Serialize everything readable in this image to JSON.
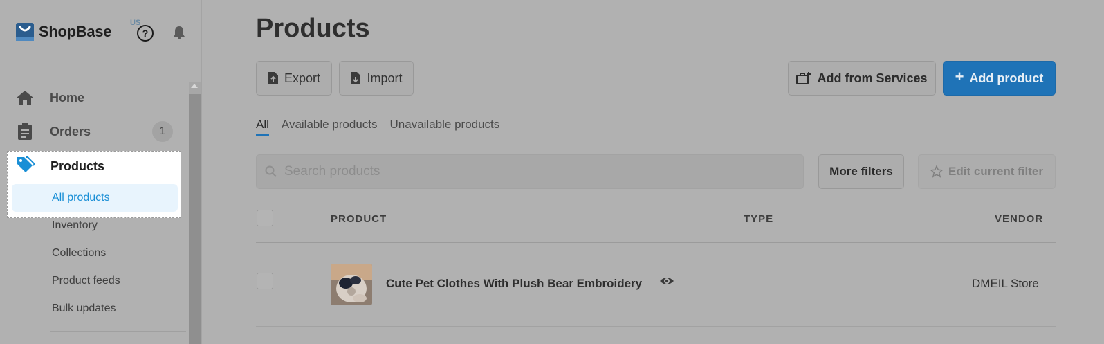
{
  "brand": {
    "name": "ShopBase",
    "region": "US"
  },
  "sidebar": {
    "items": [
      {
        "label": "Home"
      },
      {
        "label": "Orders",
        "badge": "1"
      },
      {
        "label": "Products"
      }
    ],
    "products_sub": [
      "All products",
      "Inventory",
      "Collections",
      "Product feeds",
      "Bulk updates"
    ]
  },
  "page": {
    "title": "Products",
    "export_label": "Export",
    "import_label": "Import",
    "add_from_services_label": "Add from Services",
    "add_product_label": "Add product"
  },
  "tabs": [
    "All",
    "Available products",
    "Unavailable products"
  ],
  "active_tab": "All",
  "search": {
    "placeholder": "Search products",
    "value": ""
  },
  "filters": {
    "more_label": "More filters",
    "edit_label": "Edit current filter"
  },
  "table": {
    "columns": [
      "PRODUCT",
      "TYPE",
      "VENDOR"
    ],
    "rows": [
      {
        "product": "Cute Pet Clothes With Plush Bear Embroidery",
        "type": "",
        "vendor": "DMEIL Store"
      }
    ]
  },
  "colors": {
    "accent": "#1f73b7",
    "active_nav_text": "#1a8fd6",
    "active_nav_bg": "#e8f4fd"
  },
  "icons": [
    "logo-bag-icon",
    "help-icon",
    "bell-icon",
    "home-icon",
    "clipboard-icon",
    "tag-icon",
    "file-export-icon",
    "file-import-icon",
    "services-icon",
    "plus-icon",
    "search-icon",
    "star-icon",
    "eye-icon"
  ]
}
